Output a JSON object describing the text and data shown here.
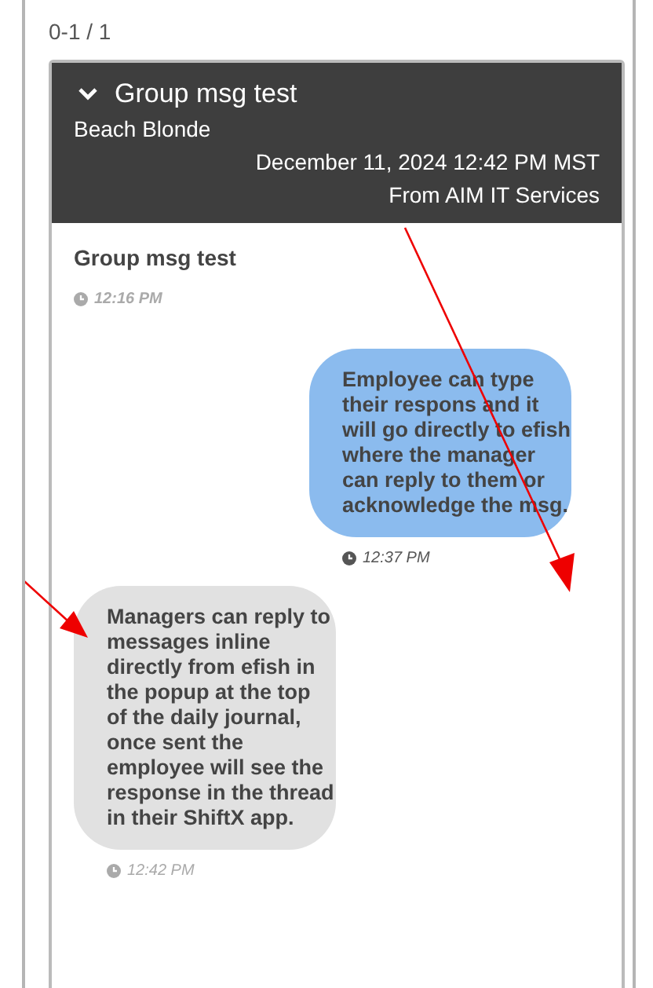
{
  "counter": "0-1 / 1",
  "thread": {
    "expanded": true,
    "title": "Group msg test",
    "sender": "Beach Blonde",
    "date": "December 11, 2024 12:42 PM MST",
    "source": "From AIM IT Services"
  },
  "messages": [
    {
      "kind": "subject",
      "text": "Group msg test",
      "time": "12:16 PM"
    },
    {
      "kind": "outgoing",
      "text": "Employee can type their respons and it will go directly to efish where the manager can reply to them or acknowledge the msg.",
      "time": "12:37 PM"
    },
    {
      "kind": "incoming",
      "text": "Managers can reply to messages inline directly from efish in the popup at the top of the daily journal, once sent the employee will see the response in the thread in their ShiftX app.",
      "time": "12:42 PM"
    }
  ]
}
